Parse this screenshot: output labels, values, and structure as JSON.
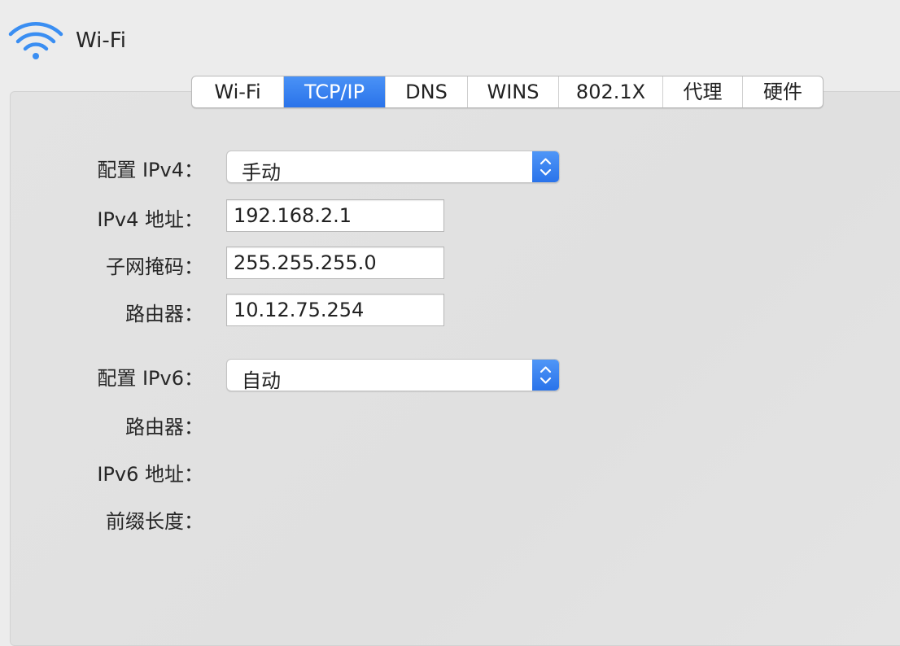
{
  "header": {
    "title": "Wi-Fi",
    "icon": "wifi-icon"
  },
  "tabs": [
    {
      "label": "Wi-Fi",
      "active": false
    },
    {
      "label": "TCP/IP",
      "active": true
    },
    {
      "label": "DNS",
      "active": false
    },
    {
      "label": "WINS",
      "active": false
    },
    {
      "label": "802.1X",
      "active": false
    },
    {
      "label": "代理",
      "active": false
    },
    {
      "label": "硬件",
      "active": false
    }
  ],
  "ipv4": {
    "configure_label": "配置 IPv4：",
    "configure_value": "手动",
    "address_label": "IPv4 地址：",
    "address_value": "192.168.2.1",
    "subnet_label": "子网掩码：",
    "subnet_value": "255.255.255.0",
    "router_label": "路由器：",
    "router_value": "10.12.75.254"
  },
  "ipv6": {
    "configure_label": "配置 IPv6：",
    "configure_value": "自动",
    "router_label": "路由器：",
    "address_label": "IPv6 地址：",
    "prefix_label": "前缀长度："
  },
  "colors": {
    "accent": "#2f7bef",
    "background": "#ececec"
  }
}
